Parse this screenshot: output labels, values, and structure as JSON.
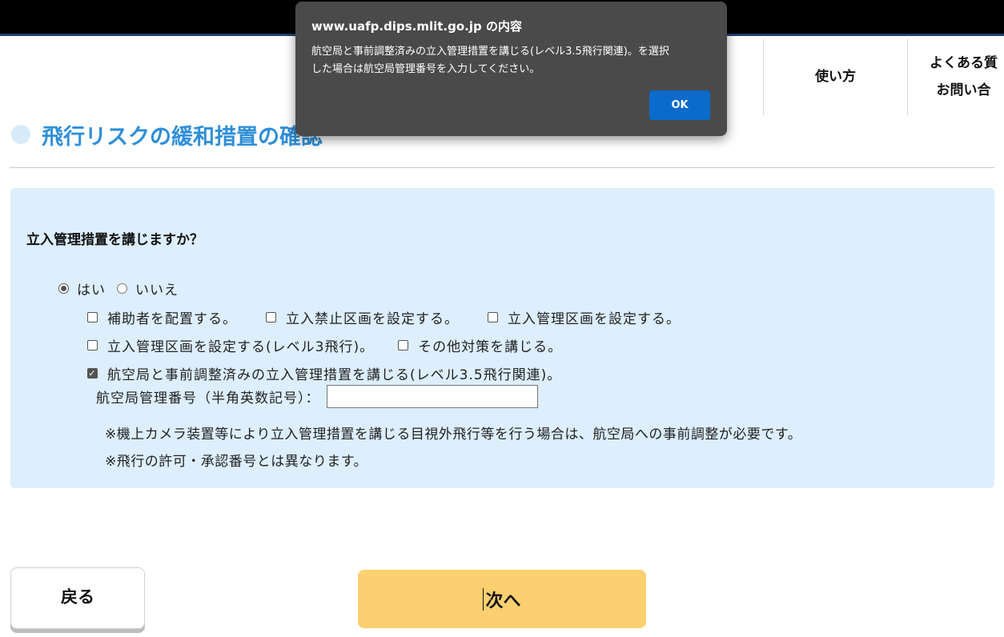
{
  "nav": {
    "howto_label": "使い方",
    "faq_line1": "よくある質",
    "faq_line2": "お問い合"
  },
  "page": {
    "title": "飛行リスクの緩和措置の確認"
  },
  "form": {
    "question": "立入管理措置を講じますか？",
    "radio_yes": "はい",
    "radio_no": "いいえ",
    "radio_selected": "はい",
    "checkboxes": [
      {
        "label": "補助者を配置する。",
        "checked": false
      },
      {
        "label": "立入禁止区画を設定する。",
        "checked": false
      },
      {
        "label": "立入管理区画を設定する。",
        "checked": false
      },
      {
        "label": "立入管理区画を設定する(レベル3飛行)。",
        "checked": false
      },
      {
        "label": "その他対策を講じる。",
        "checked": false
      },
      {
        "label": "航空局と事前調整済みの立入管理措置を講じる(レベル3.5飛行関連)。",
        "checked": true
      }
    ],
    "number_label": "航空局管理番号（半角英数記号）：",
    "number_value": "",
    "note1": "※機上カメラ装置等により立入管理措置を講じる目視外飛行等を行う場合は、航空局への事前調整が必要です。",
    "note2": "※飛行の許可・承認番号とは異なります。"
  },
  "buttons": {
    "back": "戻る",
    "next": "次へ"
  },
  "dialog": {
    "title": "www.uafp.dips.mlit.go.jp の内容",
    "message_line1": "航空局と事前調整済みの立入管理措置を講じる(レベル3.5飛行関連)。を選択",
    "message_line2": "した場合は航空局管理番号を入力してください。",
    "ok": "OK"
  },
  "colors": {
    "accent": "#2f8fd8",
    "panel": "#ddeefd",
    "next_button": "#fcd070",
    "dialog_bg": "#4a4a4a",
    "ok_button": "#0b6bcb"
  }
}
